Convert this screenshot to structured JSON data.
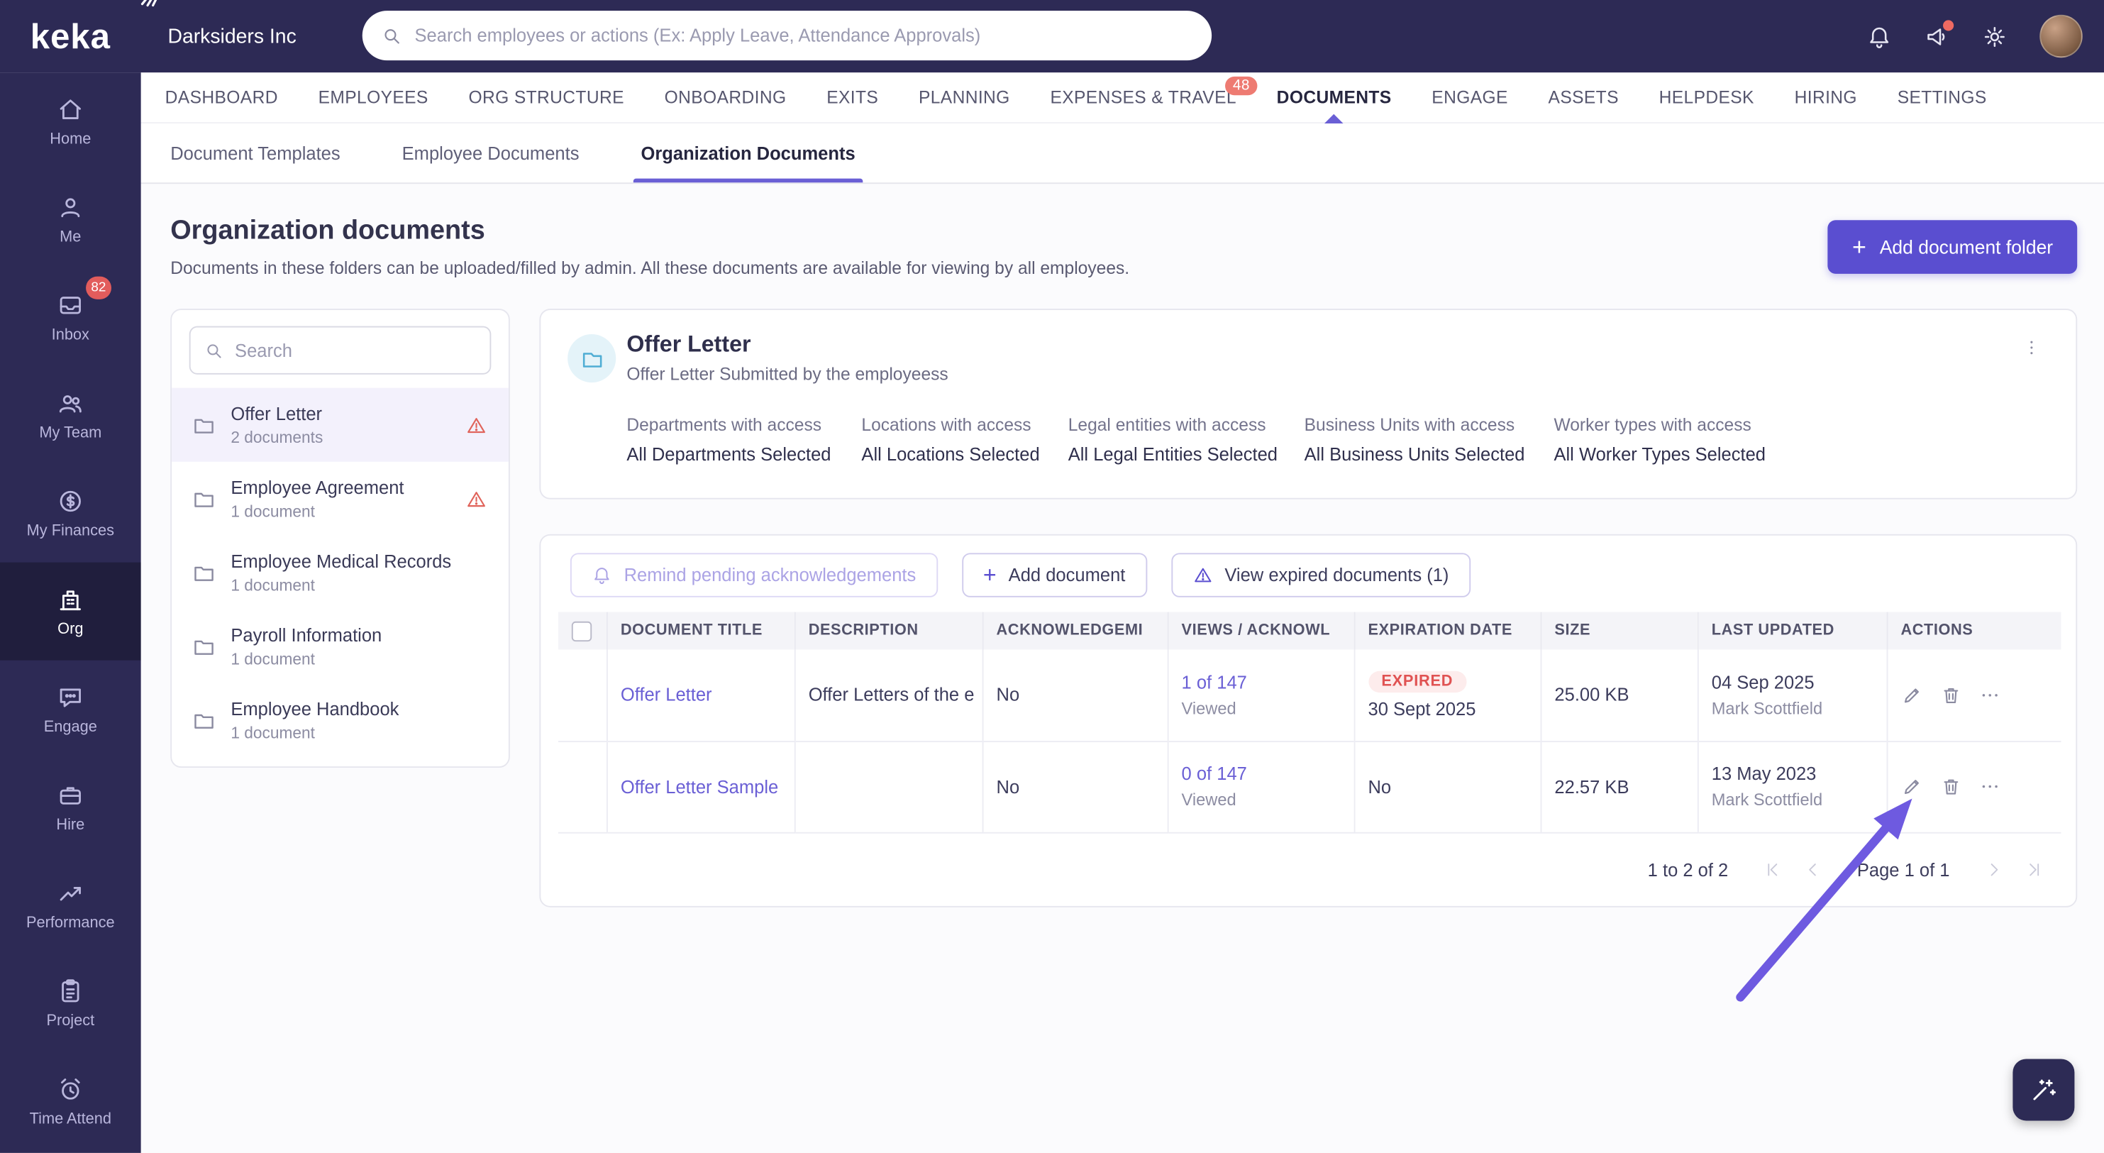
{
  "brand": {
    "logo": "keka",
    "company": "Darksiders Inc"
  },
  "topbar": {
    "search_placeholder": "Search employees or actions (Ex: Apply Leave, Attendance Approvals)"
  },
  "sidebar": {
    "items": [
      {
        "label": "Home"
      },
      {
        "label": "Me"
      },
      {
        "label": "Inbox",
        "badge": "82"
      },
      {
        "label": "My Team"
      },
      {
        "label": "My Finances"
      },
      {
        "label": "Org"
      },
      {
        "label": "Engage"
      },
      {
        "label": "Hire"
      },
      {
        "label": "Performance"
      },
      {
        "label": "Project"
      },
      {
        "label": "Time Attend"
      }
    ]
  },
  "nav": {
    "items": [
      {
        "label": "DASHBOARD"
      },
      {
        "label": "EMPLOYEES"
      },
      {
        "label": "ORG STRUCTURE"
      },
      {
        "label": "ONBOARDING"
      },
      {
        "label": "EXITS"
      },
      {
        "label": "PLANNING"
      },
      {
        "label": "EXPENSES & TRAVEL",
        "badge": "48"
      },
      {
        "label": "DOCUMENTS"
      },
      {
        "label": "ENGAGE"
      },
      {
        "label": "ASSETS"
      },
      {
        "label": "HELPDESK"
      },
      {
        "label": "HIRING"
      },
      {
        "label": "SETTINGS"
      }
    ]
  },
  "subnav": {
    "items": [
      {
        "label": "Document Templates"
      },
      {
        "label": "Employee Documents"
      },
      {
        "label": "Organization Documents"
      }
    ]
  },
  "page": {
    "title": "Organization documents",
    "subtitle": "Documents in these folders can be uploaded/filled by admin. All these documents are available for viewing by all employees.",
    "add_folder_button": "Add document folder"
  },
  "folders": {
    "search_placeholder": "Search",
    "items": [
      {
        "name": "Offer Letter",
        "count": "2 documents"
      },
      {
        "name": "Employee Agreement",
        "count": "1 document"
      },
      {
        "name": "Employee Medical Records",
        "count": "1 document"
      },
      {
        "name": "Payroll Information",
        "count": "1 document"
      },
      {
        "name": "Employee Handbook",
        "count": "1 document"
      }
    ]
  },
  "folder_detail": {
    "title": "Offer Letter",
    "subtitle": "Offer Letter Submitted by the employeess",
    "access": [
      {
        "label": "Departments with access",
        "value": "All Departments Selected"
      },
      {
        "label": "Locations with access",
        "value": "All Locations Selected"
      },
      {
        "label": "Legal entities with access",
        "value": "All Legal Entities Selected"
      },
      {
        "label": "Business Units with access",
        "value": "All Business Units Selected"
      },
      {
        "label": "Worker types with access",
        "value": "All Worker Types Selected"
      }
    ]
  },
  "documents": {
    "toolbar": {
      "remind": "Remind pending acknowledgements",
      "add": "Add document",
      "expired": "View expired documents (1)"
    },
    "columns": [
      "DOCUMENT TITLE",
      "DESCRIPTION",
      "ACKNOWLEDGEMI",
      "VIEWS / ACKNOWL",
      "EXPIRATION DATE",
      "SIZE",
      "LAST UPDATED",
      "ACTIONS"
    ],
    "rows": [
      {
        "title": "Offer Letter",
        "description": "Offer Letters of the e",
        "acknowledgement": "No",
        "views": "1 of 147",
        "views_sub": "Viewed",
        "expiration_badge": "EXPIRED",
        "expiration_date": "30 Sept 2025",
        "size": "25.00 KB",
        "updated_date": "04 Sep 2025",
        "updated_by": "Mark Scottfield"
      },
      {
        "title": "Offer Letter Sample",
        "description": "",
        "acknowledgement": "No",
        "views": "0 of 147",
        "views_sub": "Viewed",
        "expiration": "No",
        "size": "22.57 KB",
        "updated_date": "13 May 2023",
        "updated_by": "Mark Scottfield"
      }
    ],
    "pagination": {
      "range": "1 to 2 of 2",
      "page": "Page 1 of 1"
    }
  },
  "colors": {
    "accent": "#5a4ed0",
    "sidebar_bg": "#2d2a55",
    "danger": "#e25c5c",
    "expired_badge_bg": "#fdecec",
    "folder_icon": "#4fadd4",
    "annotation_arrow": "#6e5ae0"
  }
}
